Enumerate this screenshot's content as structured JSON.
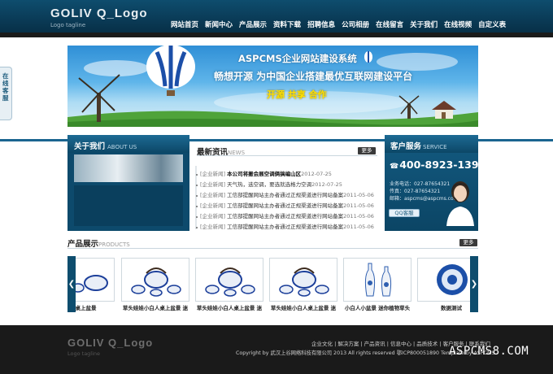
{
  "header": {
    "logo_text": "GOLIV Q_Logo",
    "logo_sub": "Logo tagline",
    "nav": [
      "网站首页",
      "新闻中心",
      "产品展示",
      "资料下载",
      "招聘信息",
      "公司相册",
      "在线留言",
      "关于我们",
      "在线视频",
      "自定义表"
    ]
  },
  "side_tab": {
    "label": "在线客服"
  },
  "banner": {
    "title": "ASPCMS企业网站建设系统",
    "slogan": "畅想开源 为中国企业搭建最优互联网建设平台",
    "tag": "开源 共享 合作"
  },
  "about": {
    "title": "关于我们",
    "subtitle": "ABOUT US"
  },
  "news": {
    "title": "最新资讯",
    "subtitle": "NEWS",
    "more": "更多",
    "items": [
      {
        "category": "[企业新闻]",
        "title": "本公司将搬会展空调俩搞编山区",
        "date": "2012-07-25"
      },
      {
        "category": "[企业新闻]",
        "title": "天气热，选空调，要选就选格力空调",
        "date": "2012-07-25"
      },
      {
        "category": "[企业新闻]",
        "title": "工信部提醒网站主办者通过正规渠道进行网站备案",
        "date": "2011-05-06"
      },
      {
        "category": "[企业新闻]",
        "title": "工信部提醒网站主办者通过正规渠道进行网站备案",
        "date": "2011-05-06"
      },
      {
        "category": "[企业新闻]",
        "title": "工信部提醒网站主办者通过正规渠道进行网站备案",
        "date": "2011-05-06"
      },
      {
        "category": "[企业新闻]",
        "title": "工信部提醒网站主办者通过正规渠道进行网站备案",
        "date": "2011-05-06"
      }
    ]
  },
  "service": {
    "title": "客户服务",
    "subtitle": "SERVICE",
    "phone": "400-8923-139",
    "info": [
      "业务电话：027-87654321",
      "传真：027-87654321",
      "邮箱：aspcms@aspcms.com"
    ],
    "qq": "QQ客服"
  },
  "products": {
    "title": "产品展示",
    "subtitle": "PRODUCTS",
    "more": "更多",
    "items": [
      {
        "name": "小人桌上盆景"
      },
      {
        "name": "草头娃娃小白人桌上盆景 迷"
      },
      {
        "name": "草头娃娃小白人桌上盆景 迷"
      },
      {
        "name": "草头娃娃小白人桌上盆景 迷"
      },
      {
        "name": "小白人小盆景 迷你植物草头"
      },
      {
        "name": "数据测试"
      }
    ]
  },
  "footer": {
    "logo_text": "GOLIV Q_Logo",
    "logo_sub": "Logo tagline",
    "links": "企业文化 | 解决方案 | 产品资讯 | 信息中心 | 品质技术 | 客户服务 | 联系我们",
    "copyright": "Copyright by 武汉上谷网络科技有限公司 2013 All rights reserved 鄂ICP800051890 Template by ASPCMS"
  },
  "watermark": "ASPCMS8.COM"
}
